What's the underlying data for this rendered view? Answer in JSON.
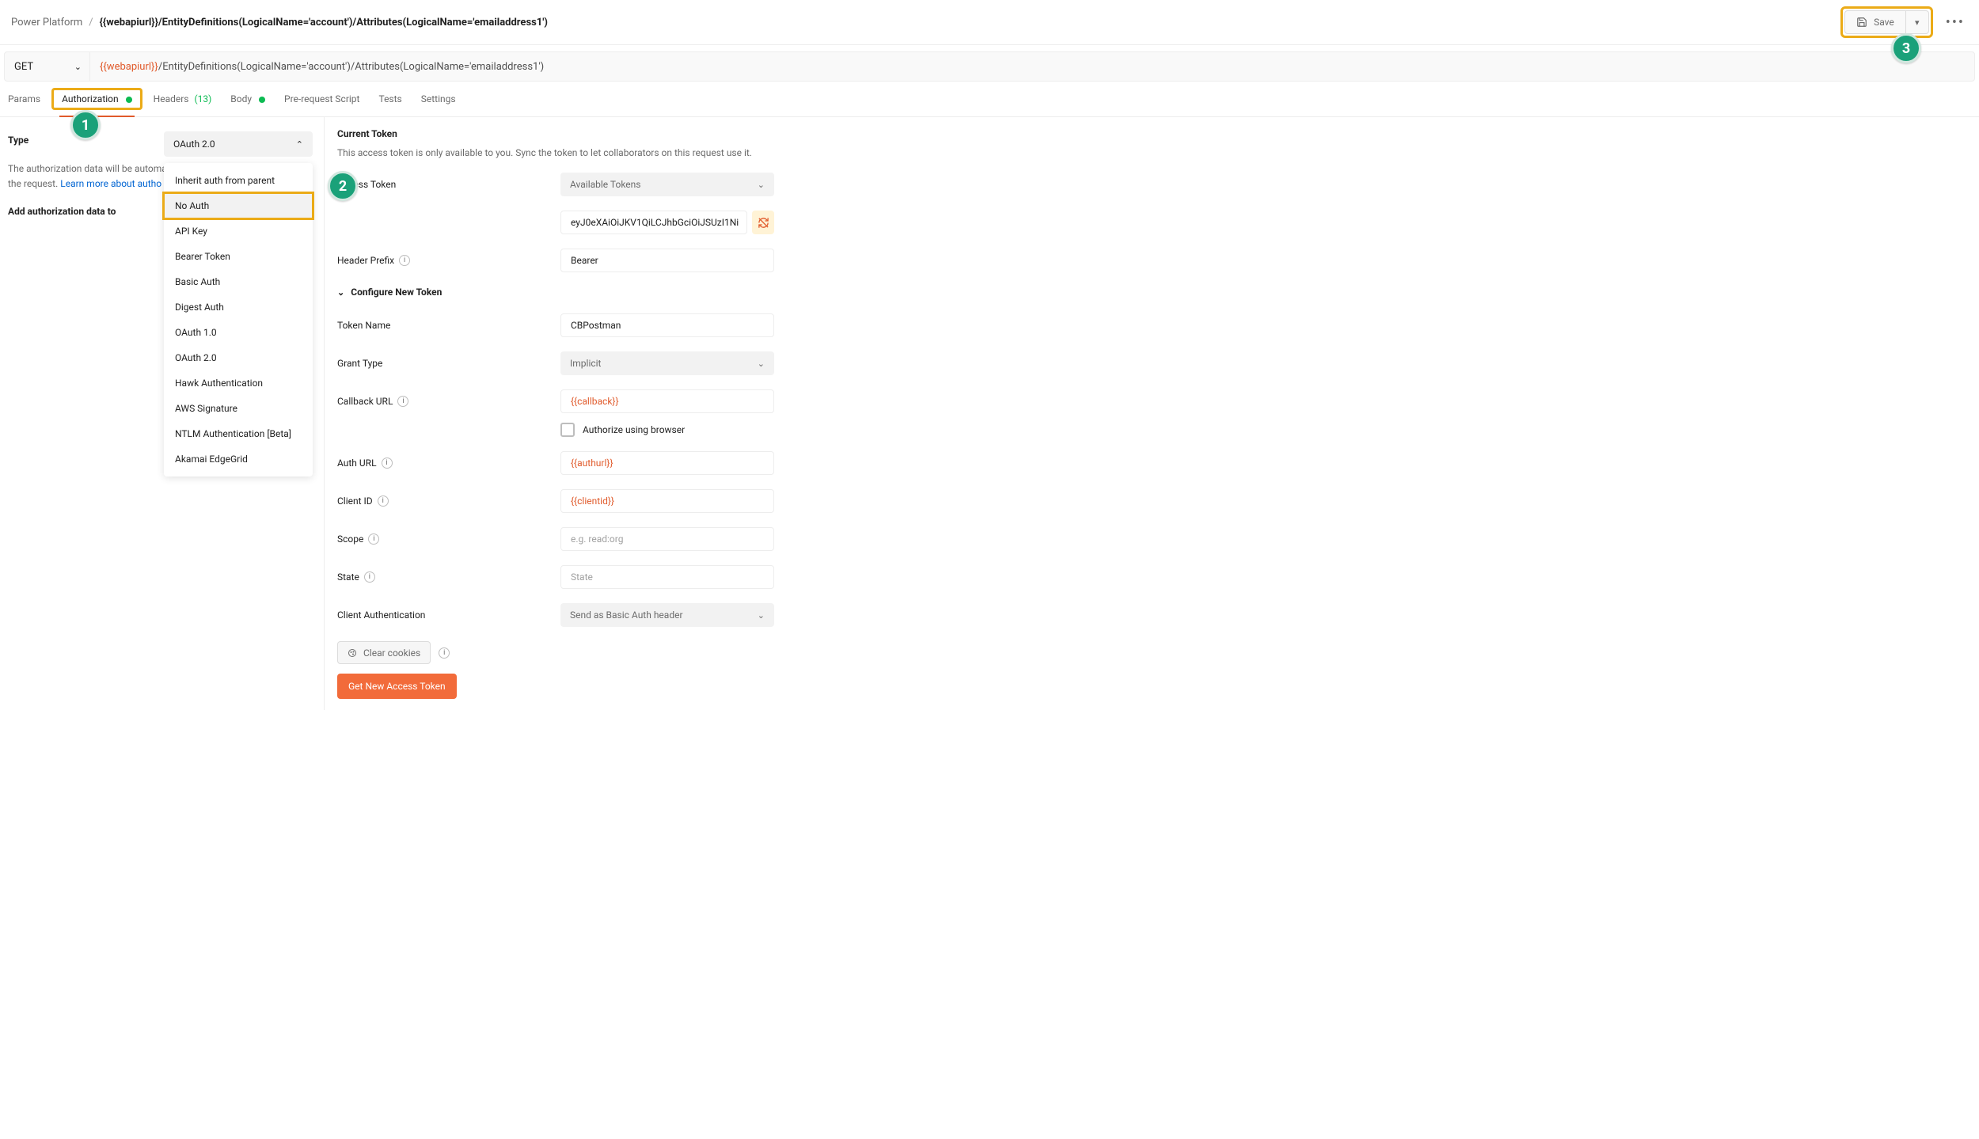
{
  "breadcrumb": {
    "root": "Power Platform",
    "sep": "/",
    "title": "{{webapiurl}}/EntityDefinitions(LogicalName='account')/Attributes(LogicalName='emailaddress1')"
  },
  "save": {
    "label": "Save"
  },
  "method": {
    "verb": "GET",
    "url_prefix": "{{webapiurl}}",
    "url_rest": "/EntityDefinitions(LogicalName='account')/Attributes(LogicalName='emailaddress1')"
  },
  "tabs": {
    "params": "Params",
    "authorization": "Authorization",
    "headers": "Headers",
    "headers_count": "(13)",
    "body": "Body",
    "prerequest": "Pre-request Script",
    "tests": "Tests",
    "settings": "Settings"
  },
  "left": {
    "type_label": "Type",
    "hint_part1": "The authorization data will be automa",
    "hint_part2": "the request. ",
    "hint_link": "Learn more about autho",
    "add_to_label": "Add authorization data to"
  },
  "dropdown": {
    "selected": "OAuth 2.0",
    "items": [
      "Inherit auth from parent",
      "No Auth",
      "API Key",
      "Bearer Token",
      "Basic Auth",
      "Digest Auth",
      "OAuth 1.0",
      "OAuth 2.0",
      "Hawk Authentication",
      "AWS Signature",
      "NTLM Authentication [Beta]",
      "Akamai EdgeGrid"
    ]
  },
  "right": {
    "current_token_title": "Current Token",
    "current_token_sub": "This access token is only available to you. Sync the token to let collaborators on this request use it.",
    "access_token_label": "Access Token",
    "available_tokens": "Available Tokens",
    "token_value": "eyJ0eXAiOiJKV1QiLCJhbGciOiJSUzI1Ni",
    "header_prefix_label": "Header Prefix",
    "header_prefix_value": "Bearer",
    "configure_title": "Configure New Token",
    "token_name_label": "Token Name",
    "token_name_value": "CBPostman",
    "grant_type_label": "Grant Type",
    "grant_type_value": "Implicit",
    "callback_label": "Callback URL",
    "callback_value": "{{callback}}",
    "authorize_browser": "Authorize using browser",
    "auth_url_label": "Auth URL",
    "auth_url_value": "{{authurl}}",
    "client_id_label": "Client ID",
    "client_id_value": "{{clientid}}",
    "scope_label": "Scope",
    "scope_placeholder": "e.g. read:org",
    "state_label": "State",
    "state_placeholder": "State",
    "client_auth_label": "Client Authentication",
    "client_auth_value": "Send as Basic Auth header",
    "clear_cookies": "Clear cookies",
    "get_token_btn": "Get New Access Token"
  },
  "callouts": {
    "c1": "1",
    "c2": "2",
    "c3": "3"
  }
}
